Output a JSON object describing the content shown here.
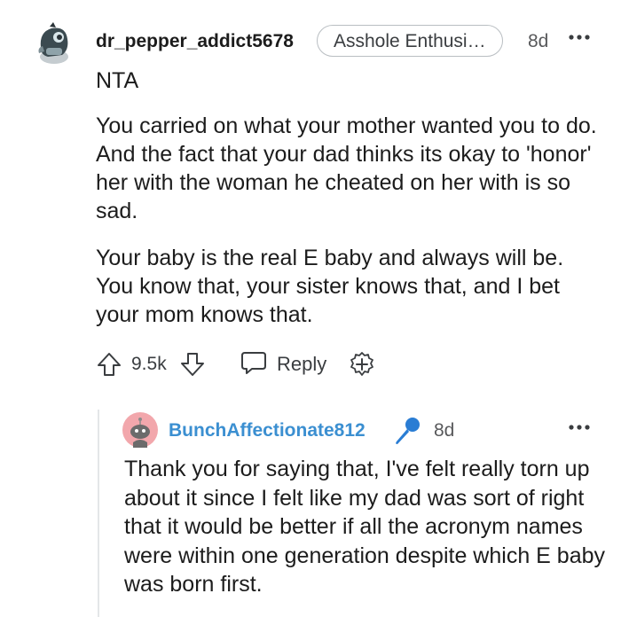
{
  "comment": {
    "username": "dr_pepper_addict5678",
    "flair": "Asshole Enthusi…",
    "time": "8d",
    "paragraphs": [
      "NTA",
      "You carried on what your mother wanted you to do. And the fact that your dad thinks its okay to 'honor' her with the woman he cheated on her with is so sad.",
      "Your baby is the real E baby and always will be. You know that, your sister knows that, and I bet your mom knows that."
    ],
    "actions": {
      "votes": "9.5k",
      "reply_label": "Reply"
    },
    "icons": [
      "avatar",
      "more-options-icon",
      "upvote-icon",
      "downvote-icon",
      "reply-icon",
      "award-icon"
    ]
  },
  "reply": {
    "username": "BunchAffectionate812",
    "time": "8d",
    "text": "Thank you for saying that, I've felt really torn up about it since I felt like my dad was sort of right that it would be better if all the acronym names were within one generation despite which E baby was born first.",
    "icons": [
      "avatar",
      "op-microphone-icon",
      "more-options-icon"
    ]
  },
  "colors": {
    "username_reply": "#3b8fd1",
    "mic_icon": "#2a7dd4",
    "avatar_reply_bg": "#f2a7ac",
    "text": "#1c1c1c",
    "muted": "#58595b"
  }
}
